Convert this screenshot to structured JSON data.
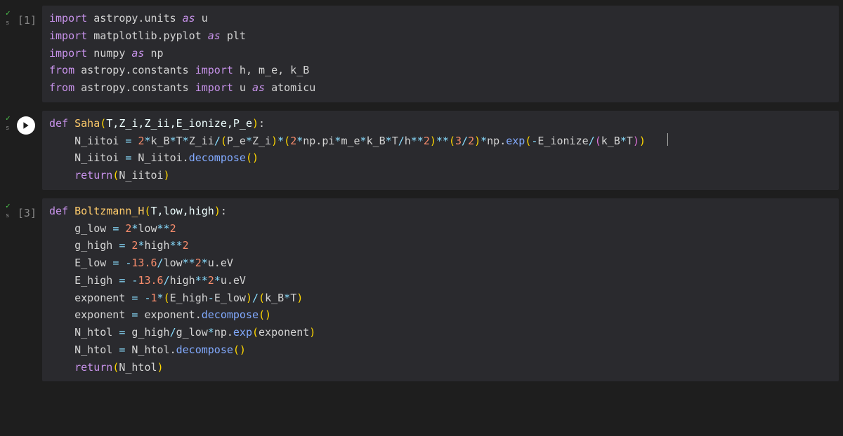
{
  "cells": [
    {
      "status": "ok",
      "prompt": "[1]",
      "has_run_button": false,
      "lines": [
        [
          [
            "kw",
            "import"
          ],
          [
            "plain",
            " astropy.units "
          ],
          [
            "as",
            "as"
          ],
          [
            "plain",
            " u"
          ]
        ],
        [
          [
            "kw",
            "import"
          ],
          [
            "plain",
            " matplotlib.pyplot "
          ],
          [
            "as",
            "as"
          ],
          [
            "plain",
            " plt"
          ]
        ],
        [
          [
            "kw",
            "import"
          ],
          [
            "plain",
            " numpy "
          ],
          [
            "as",
            "as"
          ],
          [
            "plain",
            " np"
          ]
        ],
        [
          [
            "kw",
            "from"
          ],
          [
            "plain",
            " astropy.constants "
          ],
          [
            "kw",
            "import"
          ],
          [
            "plain",
            " h, m_e, k_B"
          ]
        ],
        [
          [
            "kw",
            "from"
          ],
          [
            "plain",
            " astropy.constants "
          ],
          [
            "kw",
            "import"
          ],
          [
            "plain",
            " u "
          ],
          [
            "as",
            "as"
          ],
          [
            "plain",
            " atomicu"
          ]
        ]
      ]
    },
    {
      "status": "ok",
      "prompt": "",
      "has_run_button": true,
      "lines": [
        [
          [
            "def",
            "def"
          ],
          [
            "plain",
            " "
          ],
          [
            "fname",
            "Saha"
          ],
          [
            "paren",
            "("
          ],
          [
            "param",
            "T,Z_i,Z_ii,E_ionize,P_e"
          ],
          [
            "paren",
            ")"
          ],
          [
            "plain",
            ":"
          ]
        ],
        [
          [
            "plain",
            "    N_iitoi "
          ],
          [
            "op",
            "="
          ],
          [
            "plain",
            " "
          ],
          [
            "num",
            "2"
          ],
          [
            "op",
            "*"
          ],
          [
            "plain",
            "k_B"
          ],
          [
            "op",
            "*"
          ],
          [
            "plain",
            "T"
          ],
          [
            "op",
            "*"
          ],
          [
            "plain",
            "Z_ii"
          ],
          [
            "op",
            "/"
          ],
          [
            "paren",
            "("
          ],
          [
            "plain",
            "P_e"
          ],
          [
            "op",
            "*"
          ],
          [
            "plain",
            "Z_i"
          ],
          [
            "paren",
            ")"
          ],
          [
            "op",
            "*"
          ],
          [
            "paren",
            "("
          ],
          [
            "num",
            "2"
          ],
          [
            "op",
            "*"
          ],
          [
            "plain",
            "np.pi"
          ],
          [
            "op",
            "*"
          ],
          [
            "plain",
            "m_e"
          ],
          [
            "op",
            "*"
          ],
          [
            "plain",
            "k_B"
          ],
          [
            "op",
            "*"
          ],
          [
            "plain",
            "T"
          ],
          [
            "op",
            "/"
          ],
          [
            "plain",
            "h"
          ],
          [
            "op",
            "**"
          ],
          [
            "num",
            "2"
          ],
          [
            "paren",
            ")"
          ],
          [
            "op",
            "**"
          ],
          [
            "paren",
            "("
          ],
          [
            "num",
            "3"
          ],
          [
            "op",
            "/"
          ],
          [
            "num",
            "2"
          ],
          [
            "paren",
            ")"
          ],
          [
            "op",
            "*"
          ],
          [
            "plain",
            "np."
          ],
          [
            "fn",
            "exp"
          ],
          [
            "paren",
            "("
          ],
          [
            "op",
            "-"
          ],
          [
            "plain",
            "E_ionize"
          ],
          [
            "op",
            "/"
          ],
          [
            "paren2",
            "("
          ],
          [
            "plain",
            "k_B"
          ],
          [
            "op",
            "*"
          ],
          [
            "plain",
            "T"
          ],
          [
            "paren2",
            ")"
          ],
          [
            "paren",
            ")"
          ]
        ],
        [
          [
            "plain",
            "    N_iitoi "
          ],
          [
            "op",
            "="
          ],
          [
            "plain",
            " N_iitoi."
          ],
          [
            "fn",
            "decompose"
          ],
          [
            "paren",
            "()"
          ]
        ],
        [
          [
            "plain",
            "    "
          ],
          [
            "kw",
            "return"
          ],
          [
            "paren",
            "("
          ],
          [
            "plain",
            "N_iitoi"
          ],
          [
            "paren",
            ")"
          ]
        ]
      ]
    },
    {
      "status": "ok",
      "prompt": "[3]",
      "has_run_button": false,
      "lines": [
        [
          [
            "def",
            "def"
          ],
          [
            "plain",
            " "
          ],
          [
            "fname",
            "Boltzmann_H"
          ],
          [
            "paren",
            "("
          ],
          [
            "param",
            "T,low,high"
          ],
          [
            "paren",
            ")"
          ],
          [
            "plain",
            ":"
          ]
        ],
        [
          [
            "plain",
            "    g_low "
          ],
          [
            "op",
            "="
          ],
          [
            "plain",
            " "
          ],
          [
            "num",
            "2"
          ],
          [
            "op",
            "*"
          ],
          [
            "plain",
            "low"
          ],
          [
            "op",
            "**"
          ],
          [
            "num",
            "2"
          ]
        ],
        [
          [
            "plain",
            "    g_high "
          ],
          [
            "op",
            "="
          ],
          [
            "plain",
            " "
          ],
          [
            "num",
            "2"
          ],
          [
            "op",
            "*"
          ],
          [
            "plain",
            "high"
          ],
          [
            "op",
            "**"
          ],
          [
            "num",
            "2"
          ]
        ],
        [
          [
            "plain",
            "    E_low "
          ],
          [
            "op",
            "="
          ],
          [
            "plain",
            " "
          ],
          [
            "op",
            "-"
          ],
          [
            "num",
            "13.6"
          ],
          [
            "op",
            "/"
          ],
          [
            "plain",
            "low"
          ],
          [
            "op",
            "**"
          ],
          [
            "num",
            "2"
          ],
          [
            "op",
            "*"
          ],
          [
            "plain",
            "u.eV"
          ]
        ],
        [
          [
            "plain",
            "    E_high "
          ],
          [
            "op",
            "="
          ],
          [
            "plain",
            " "
          ],
          [
            "op",
            "-"
          ],
          [
            "num",
            "13.6"
          ],
          [
            "op",
            "/"
          ],
          [
            "plain",
            "high"
          ],
          [
            "op",
            "**"
          ],
          [
            "num",
            "2"
          ],
          [
            "op",
            "*"
          ],
          [
            "plain",
            "u.eV"
          ]
        ],
        [
          [
            "plain",
            "    exponent "
          ],
          [
            "op",
            "="
          ],
          [
            "plain",
            " "
          ],
          [
            "op",
            "-"
          ],
          [
            "num",
            "1"
          ],
          [
            "op",
            "*"
          ],
          [
            "paren",
            "("
          ],
          [
            "plain",
            "E_high"
          ],
          [
            "op",
            "-"
          ],
          [
            "plain",
            "E_low"
          ],
          [
            "paren",
            ")"
          ],
          [
            "op",
            "/"
          ],
          [
            "paren",
            "("
          ],
          [
            "plain",
            "k_B"
          ],
          [
            "op",
            "*"
          ],
          [
            "plain",
            "T"
          ],
          [
            "paren",
            ")"
          ]
        ],
        [
          [
            "plain",
            "    exponent "
          ],
          [
            "op",
            "="
          ],
          [
            "plain",
            " exponent."
          ],
          [
            "fn",
            "decompose"
          ],
          [
            "paren",
            "()"
          ]
        ],
        [
          [
            "plain",
            "    N_htol "
          ],
          [
            "op",
            "="
          ],
          [
            "plain",
            " g_high"
          ],
          [
            "op",
            "/"
          ],
          [
            "plain",
            "g_low"
          ],
          [
            "op",
            "*"
          ],
          [
            "plain",
            "np."
          ],
          [
            "fn",
            "exp"
          ],
          [
            "paren",
            "("
          ],
          [
            "plain",
            "exponent"
          ],
          [
            "paren",
            ")"
          ]
        ],
        [
          [
            "plain",
            "    N_htol "
          ],
          [
            "op",
            "="
          ],
          [
            "plain",
            " N_htol."
          ],
          [
            "fn",
            "decompose"
          ],
          [
            "paren",
            "()"
          ]
        ],
        [
          [
            "plain",
            "    "
          ],
          [
            "kw",
            "return"
          ],
          [
            "paren",
            "("
          ],
          [
            "plain",
            "N_htol"
          ],
          [
            "paren",
            ")"
          ]
        ]
      ]
    }
  ],
  "gutter_sub": "s"
}
